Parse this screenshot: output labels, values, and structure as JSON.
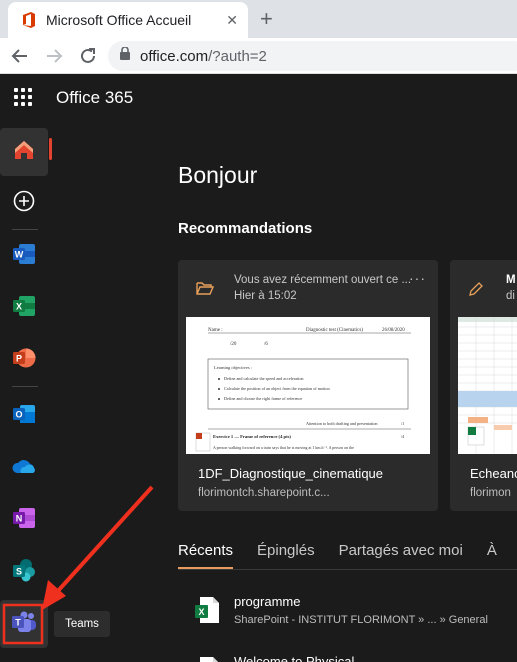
{
  "browser": {
    "tab_title": "Microsoft Office Accueil",
    "tab_close": "✕",
    "new_tab": "+",
    "url_host": "office.com",
    "url_rest": "/?auth=2"
  },
  "app": {
    "name": "Office 365"
  },
  "rail": {
    "items": [
      "home",
      "create",
      "word",
      "excel",
      "powerpoint",
      "outlook",
      "onedrive",
      "onenote",
      "sharepoint",
      "teams"
    ],
    "tooltip": "Teams"
  },
  "main": {
    "greeting": "Bonjour",
    "recommendations_heading": "Recommandations",
    "cards": [
      {
        "reason": "Vous avez récemment ouvert ce ...",
        "time": "Hier à 15:02",
        "more": "···",
        "name": "1DF_Diagnostique_cinematique",
        "location": "florimontch.sharepoint.c..."
      },
      {
        "reason": "M",
        "time": "di",
        "name": "Echeanc",
        "location": "florimon"
      }
    ],
    "tabs": [
      "Récents",
      "Épinglés",
      "Partagés avec moi",
      "À"
    ],
    "files": [
      {
        "name": "programme",
        "path": "SharePoint - INSTITUT FLORIMONT » ... » General"
      },
      {
        "name": "Welcome to Physical",
        "path": ""
      }
    ]
  },
  "doc_preview": {
    "name_label": "Name :",
    "title": "Diagnostic test (Cinematics)",
    "date": "26/08/2020",
    "score1": "/20",
    "score2": "/6",
    "objectives_heading": "Learning objectives :",
    "objectives": [
      "Define and calculate the speed and acceleration",
      "Calculate the position of an object from the equation of motion",
      "Define and choose the right frame of reference"
    ],
    "attention": "Attention to both drafting and presentation",
    "attention_score": "/1",
    "exercise": "Exercice 1 — Frame of reference (4 pts)",
    "exercise_score": "/4",
    "exercise_text": "A person walking forward on a train says that he is moving at 1 km.h⁻¹. A person on the"
  },
  "colors": {
    "accent_home": "#e2442f",
    "tab_underline": "#ea9a5d",
    "annotation_arrow": "#f0301e",
    "background": "#1b1b1b",
    "card_background": "#2b2b2b"
  }
}
